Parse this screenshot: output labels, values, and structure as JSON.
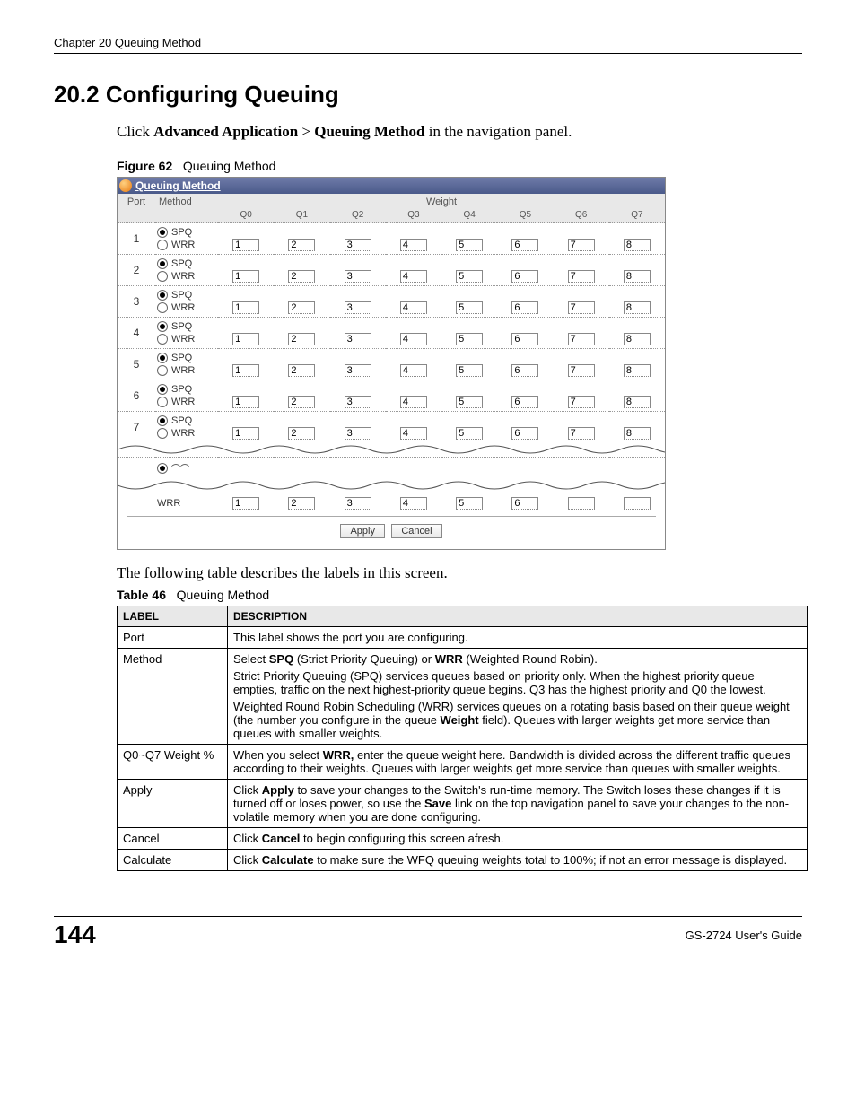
{
  "header": {
    "chapter": "Chapter 20 Queuing Method"
  },
  "section": {
    "title": "20.2  Configuring Queuing"
  },
  "instruction": {
    "prefix": "Click ",
    "b1": "Advanced Application",
    "gt": " > ",
    "b2": "Queuing Method",
    "suffix": " in the navigation panel."
  },
  "figure": {
    "label": "Figure 62",
    "caption": "Queuing Method"
  },
  "widget": {
    "title": "Queuing Method",
    "cols": {
      "port": "Port",
      "method": "Method",
      "weight": "Weight"
    },
    "qlabels": [
      "Q0",
      "Q1",
      "Q2",
      "Q3",
      "Q4",
      "Q5",
      "Q6",
      "Q7"
    ],
    "methods": {
      "spq": "SPQ",
      "wrr": "WRR"
    },
    "rows": [
      {
        "port": "1",
        "sel": "spq",
        "w": [
          "1",
          "2",
          "3",
          "4",
          "5",
          "6",
          "7",
          "8"
        ]
      },
      {
        "port": "2",
        "sel": "spq",
        "w": [
          "1",
          "2",
          "3",
          "4",
          "5",
          "6",
          "7",
          "8"
        ]
      },
      {
        "port": "3",
        "sel": "spq",
        "w": [
          "1",
          "2",
          "3",
          "4",
          "5",
          "6",
          "7",
          "8"
        ]
      },
      {
        "port": "4",
        "sel": "spq",
        "w": [
          "1",
          "2",
          "3",
          "4",
          "5",
          "6",
          "7",
          "8"
        ]
      },
      {
        "port": "5",
        "sel": "spq",
        "w": [
          "1",
          "2",
          "3",
          "4",
          "5",
          "6",
          "7",
          "8"
        ]
      },
      {
        "port": "6",
        "sel": "spq",
        "w": [
          "1",
          "2",
          "3",
          "4",
          "5",
          "6",
          "7",
          "8"
        ]
      },
      {
        "port": "7",
        "sel": "spq",
        "w": [
          "1",
          "2",
          "3",
          "4",
          "5",
          "6",
          "7",
          "8"
        ]
      }
    ],
    "torn": {
      "wrr": "WRR",
      "vals": [
        "1",
        "2",
        "3",
        "4",
        "5",
        "6",
        "",
        ""
      ]
    },
    "buttons": {
      "apply": "Apply",
      "cancel": "Cancel"
    }
  },
  "aftertext": "The following table describes the labels in this screen.",
  "table": {
    "label": "Table 46",
    "caption": "Queuing Method",
    "head": {
      "label": "LABEL",
      "desc": "DESCRIPTION"
    },
    "rows": [
      {
        "label": "Port",
        "paras": [
          "This label shows the port you are configuring."
        ]
      },
      {
        "label": "Method",
        "paras": [
          "Select <b>SPQ</b> (Strict Priority Queuing) or <b>WRR</b> (Weighted Round Robin).",
          "Strict Priority Queuing (SPQ) services queues based on priority only. When the highest priority queue empties, traffic on the next highest-priority queue begins. Q3 has the highest priority and Q0 the lowest.",
          "Weighted Round Robin Scheduling (WRR) services queues on a rotating basis based on their queue weight (the number you configure in the queue <b>Weight</b> field). Queues with larger weights get more service than queues with smaller weights."
        ]
      },
      {
        "label": "Q0~Q7 Weight %",
        "paras": [
          "When you select <b>WRR,</b> enter the queue weight here. Bandwidth is divided across the different traffic queues according to their weights. Queues with larger weights get more service than queues with smaller weights."
        ]
      },
      {
        "label": "Apply",
        "paras": [
          "Click <b>Apply</b> to save your changes to the Switch's run-time memory. The Switch loses these changes if it is turned off or loses power, so use the <b>Save</b> link on the top navigation panel to save your changes to the non-volatile memory when you are done configuring."
        ]
      },
      {
        "label": "Cancel",
        "paras": [
          "Click <b>Cancel</b> to begin configuring this screen afresh."
        ]
      },
      {
        "label": "Calculate",
        "paras": [
          "Click <b>Calculate</b> to make sure the WFQ queuing weights total to 100%; if not an error message is displayed."
        ]
      }
    ]
  },
  "footer": {
    "page": "144",
    "guide": "GS-2724 User's Guide"
  }
}
